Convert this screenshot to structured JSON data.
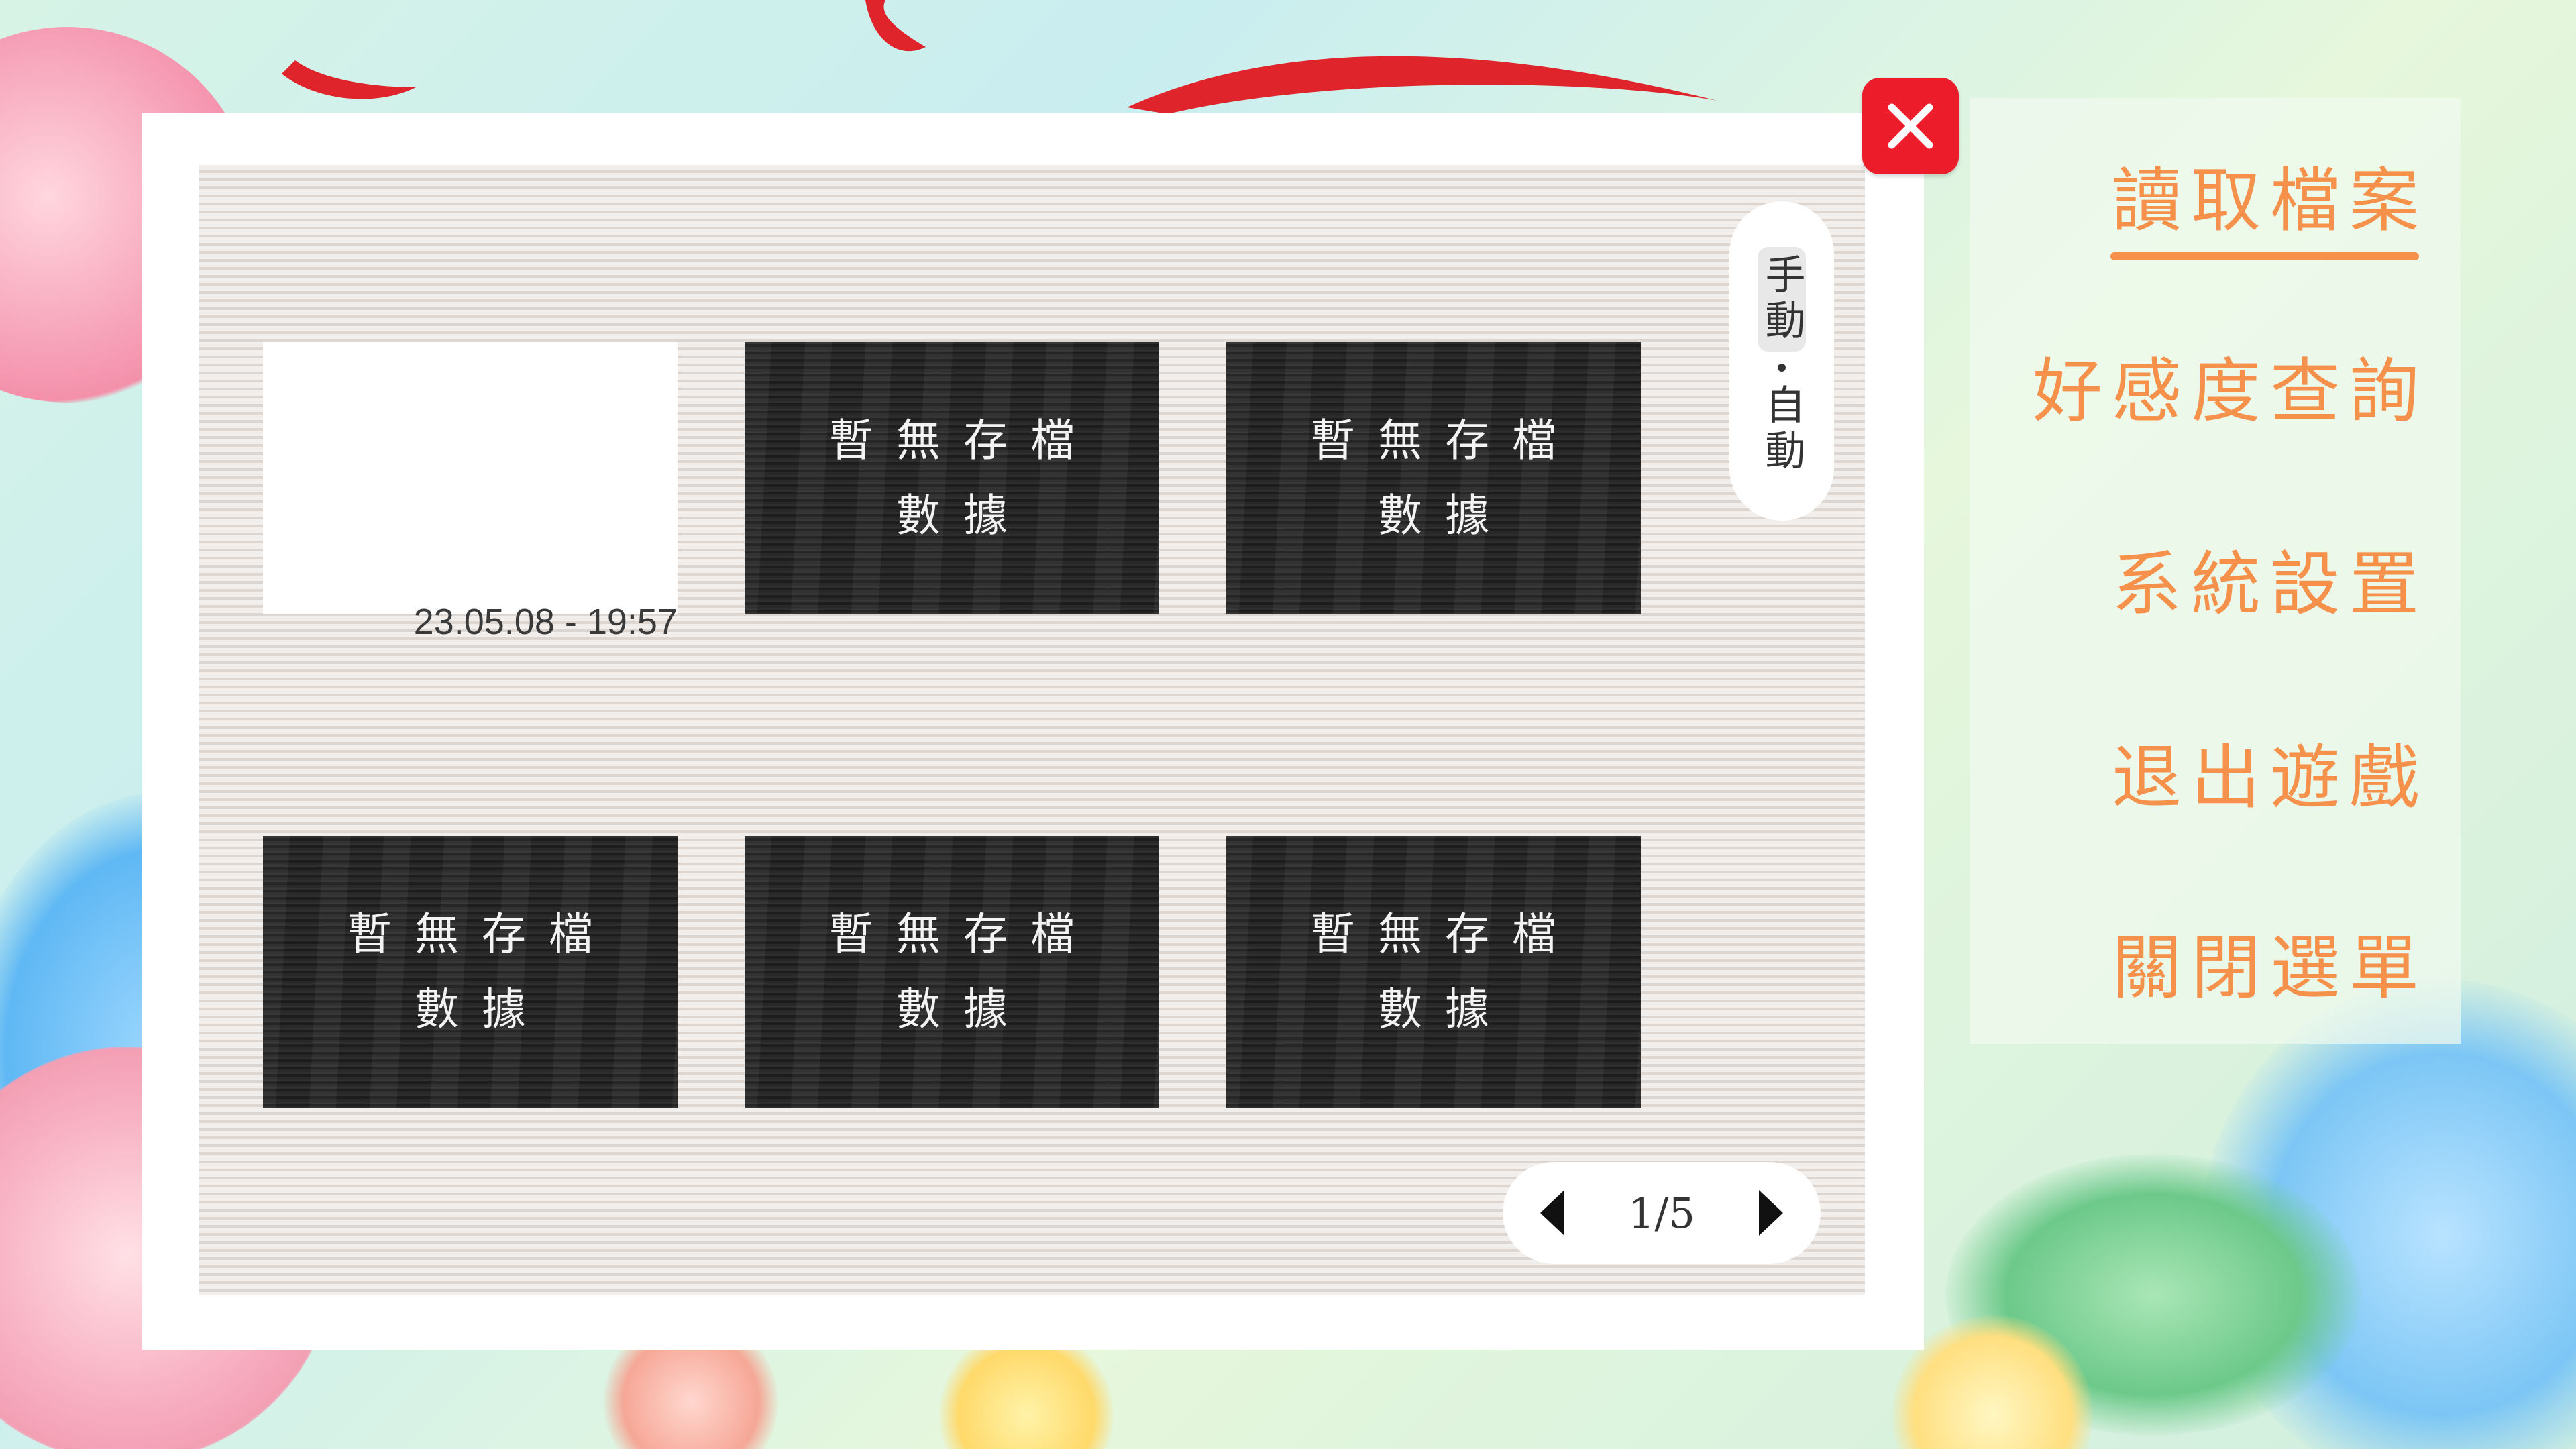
{
  "save_slots": [
    {
      "filled": true,
      "date": "23.05.08 - 19:57"
    },
    {
      "filled": false,
      "empty_line1": "暫無存檔",
      "empty_line2": "數據"
    },
    {
      "filled": false,
      "empty_line1": "暫無存檔",
      "empty_line2": "數據"
    },
    {
      "filled": false,
      "empty_line1": "暫無存檔",
      "empty_line2": "數據"
    },
    {
      "filled": false,
      "empty_line1": "暫無存檔",
      "empty_line2": "數據"
    },
    {
      "filled": false,
      "empty_line1": "暫無存檔",
      "empty_line2": "數據"
    }
  ],
  "mode_toggle": {
    "manual": "手動",
    "auto": "自動",
    "selected": "manual"
  },
  "pager": {
    "page": "1/5"
  },
  "close_icon": "close-icon",
  "menu": {
    "items": [
      "讀取檔案",
      "好感度查詢",
      "系統設置",
      "退出遊戲",
      "關閉選單"
    ],
    "active": 0
  },
  "colors": {
    "accent": "#f5914a",
    "close": "#ec1c2a",
    "slot_empty": "#232323",
    "panel_bg": "#e6e0dc"
  }
}
